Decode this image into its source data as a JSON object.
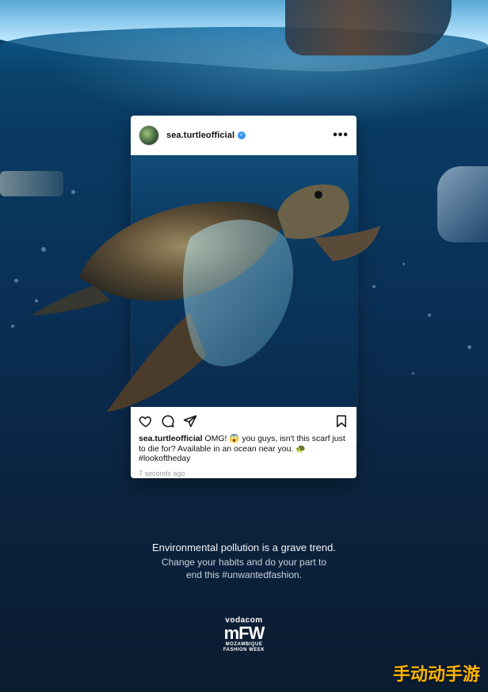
{
  "post": {
    "username": "sea.turtleofficial",
    "more_label": "•••",
    "caption_user": "sea.turtleofficial",
    "caption_text": " OMG! 😱 you guys, isn't this scarf just to die for? Available in an ocean near you. 🐢 #lookoftheday",
    "timestamp": "7 seconds ago"
  },
  "message": {
    "headline": "Environmental pollution is a grave trend.",
    "line1": "Change your habits and do your part to",
    "line2": "end this #unwantedfashion."
  },
  "logo": {
    "brand": "vodacom",
    "mark": "mFW",
    "line1": "MOZAMBIQUE",
    "line2": "FASHION WEEK"
  },
  "watermark": "手动动手游",
  "colors": {
    "verified": "#3897f0",
    "watermark": "#ffb400"
  },
  "icons": [
    "heart-icon",
    "comment-icon",
    "share-icon",
    "bookmark-icon",
    "verified-icon",
    "more-icon"
  ]
}
